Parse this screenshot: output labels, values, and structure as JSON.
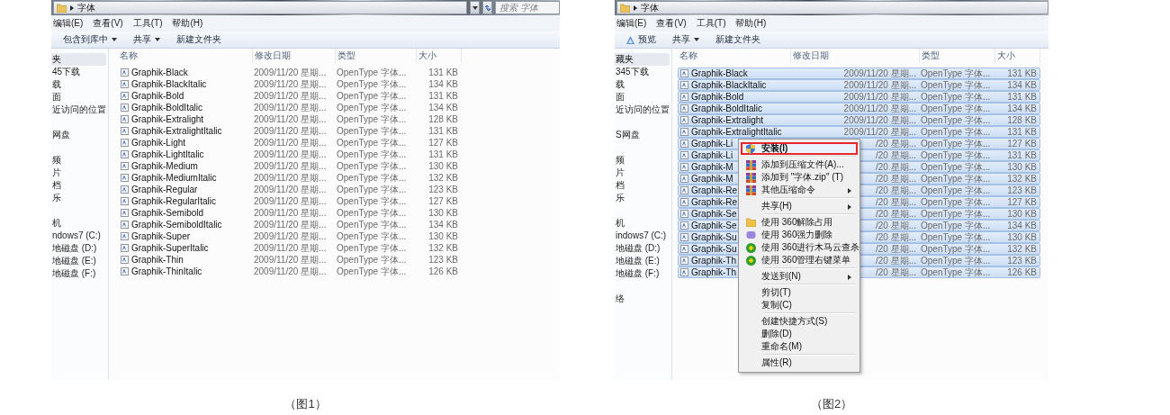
{
  "panels": [
    {
      "address": {
        "path": "字体",
        "search_placeholder": "搜索 字体"
      },
      "menu": [
        "编辑(E)",
        "查看(V)",
        "工具(T)",
        "帮助(H)"
      ],
      "toolbar": [
        {
          "kind": "plain",
          "label": "包含到库中",
          "dropdown": true
        },
        {
          "kind": "plain",
          "label": "共享",
          "dropdown": true
        },
        {
          "kind": "plain",
          "label": "新建文件夹",
          "dropdown": false
        }
      ],
      "sidebar": [
        {
          "items": [
            {
              "label": "夹",
              "selected": true
            },
            {
              "label": "45下载",
              "selected": false
            },
            {
              "label": "载",
              "selected": false
            },
            {
              "label": "面",
              "selected": false
            },
            {
              "label": "近访问的位置",
              "selected": false
            }
          ]
        },
        {
          "items": [
            {
              "label": "网盘",
              "selected": false
            }
          ]
        },
        {
          "items": [
            {
              "label": "频",
              "selected": false
            },
            {
              "label": "片",
              "selected": false
            },
            {
              "label": "档",
              "selected": false
            },
            {
              "label": "乐",
              "selected": false
            }
          ]
        },
        {
          "items": [
            {
              "label": "机",
              "selected": false
            },
            {
              "label": "ndows7 (C:)",
              "selected": false
            },
            {
              "label": "地磁盘 (D:)",
              "selected": false
            },
            {
              "label": "地磁盘 (E:)",
              "selected": false
            },
            {
              "label": "地磁盘 (F:)",
              "selected": false
            }
          ]
        }
      ],
      "columns": [
        "名称",
        "修改日期",
        "类型",
        "大小"
      ],
      "files": [
        {
          "name": "Graphik-Black",
          "date": "2009/11/20 星期...",
          "type": "OpenType 字体...",
          "size": "131 KB",
          "selected": false
        },
        {
          "name": "Graphik-BlackItalic",
          "date": "2009/11/20 星期...",
          "type": "OpenType 字体...",
          "size": "134 KB",
          "selected": false
        },
        {
          "name": "Graphik-Bold",
          "date": "2009/11/20 星期...",
          "type": "OpenType 字体...",
          "size": "131 KB",
          "selected": false
        },
        {
          "name": "Graphik-BoldItalic",
          "date": "2009/11/20 星期...",
          "type": "OpenType 字体...",
          "size": "134 KB",
          "selected": false
        },
        {
          "name": "Graphik-Extralight",
          "date": "2009/11/20 星期...",
          "type": "OpenType 字体...",
          "size": "128 KB",
          "selected": false
        },
        {
          "name": "Graphik-ExtralightItalic",
          "date": "2009/11/20 星期...",
          "type": "OpenType 字体...",
          "size": "131 KB",
          "selected": false
        },
        {
          "name": "Graphik-Light",
          "date": "2009/11/20 星期...",
          "type": "OpenType 字体...",
          "size": "127 KB",
          "selected": false
        },
        {
          "name": "Graphik-LightItalic",
          "date": "2009/11/20 星期...",
          "type": "OpenType 字体...",
          "size": "131 KB",
          "selected": false
        },
        {
          "name": "Graphik-Medium",
          "date": "2009/11/20 星期...",
          "type": "OpenType 字体...",
          "size": "130 KB",
          "selected": false
        },
        {
          "name": "Graphik-MediumItalic",
          "date": "2009/11/20 星期...",
          "type": "OpenType 字体...",
          "size": "132 KB",
          "selected": false
        },
        {
          "name": "Graphik-Regular",
          "date": "2009/11/20 星期...",
          "type": "OpenType 字体...",
          "size": "123 KB",
          "selected": false
        },
        {
          "name": "Graphik-RegularItalic",
          "date": "2009/11/20 星期...",
          "type": "OpenType 字体...",
          "size": "127 KB",
          "selected": false
        },
        {
          "name": "Graphik-Semibold",
          "date": "2009/11/20 星期...",
          "type": "OpenType 字体...",
          "size": "130 KB",
          "selected": false
        },
        {
          "name": "Graphik-SemiboldItalic",
          "date": "2009/11/20 星期...",
          "type": "OpenType 字体...",
          "size": "134 KB",
          "selected": false
        },
        {
          "name": "Graphik-Super",
          "date": "2009/11/20 星期...",
          "type": "OpenType 字体...",
          "size": "130 KB",
          "selected": false
        },
        {
          "name": "Graphik-SuperItalic",
          "date": "2009/11/20 星期...",
          "type": "OpenType 字体...",
          "size": "132 KB",
          "selected": false
        },
        {
          "name": "Graphik-Thin",
          "date": "2009/11/20 星期...",
          "type": "OpenType 字体...",
          "size": "123 KB",
          "selected": false
        },
        {
          "name": "Graphik-ThinItalic",
          "date": "2009/11/20 星期...",
          "type": "OpenType 字体...",
          "size": "126 KB",
          "selected": false
        }
      ],
      "caption": "（图1）"
    },
    {
      "address": {
        "path": "字体"
      },
      "menu": [
        "编辑(E)",
        "查看(V)",
        "工具(T)",
        "帮助(H)"
      ],
      "toolbar": [
        {
          "kind": "preview",
          "label": "预览",
          "dropdown": false
        },
        {
          "kind": "plain",
          "label": "共享",
          "dropdown": true
        },
        {
          "kind": "plain",
          "label": "新建文件夹",
          "dropdown": false
        }
      ],
      "sidebar": [
        {
          "items": [
            {
              "label": "藏夹",
              "selected": true
            },
            {
              "label": "345下载",
              "selected": false
            },
            {
              "label": "载",
              "selected": false
            },
            {
              "label": "面",
              "selected": false
            },
            {
              "label": "近访问的位置",
              "selected": false
            }
          ]
        },
        {
          "items": [
            {
              "label": "S网盘",
              "selected": false
            }
          ]
        },
        {
          "items": [
            {
              "label": "频",
              "selected": false
            },
            {
              "label": "片",
              "selected": false
            },
            {
              "label": "档",
              "selected": false
            },
            {
              "label": "乐",
              "selected": false
            }
          ]
        },
        {
          "items": [
            {
              "label": "机",
              "selected": false
            },
            {
              "label": "indows7 (C:)",
              "selected": false
            },
            {
              "label": "地磁盘 (D:)",
              "selected": false
            },
            {
              "label": "地磁盘 (E:)",
              "selected": false
            },
            {
              "label": "地磁盘 (F:)",
              "selected": false
            }
          ]
        },
        {
          "items": [
            {
              "label": "络",
              "selected": false
            }
          ]
        }
      ],
      "columns": [
        "名称",
        "修改日期",
        "类型",
        "大小"
      ],
      "files": [
        {
          "name": "Graphik-Black",
          "date": "2009/11/20 星期...",
          "type": "OpenType 字体...",
          "size": "131 KB",
          "selected": true
        },
        {
          "name": "Graphik-BlackItalic",
          "date": "2009/11/20 星期...",
          "type": "OpenType 字体...",
          "size": "134 KB",
          "selected": true
        },
        {
          "name": "Graphik-Bold",
          "date": "2009/11/20 星期...",
          "type": "OpenType 字体...",
          "size": "131 KB",
          "selected": true
        },
        {
          "name": "Graphik-BoldItalic",
          "date": "2009/11/20 星期...",
          "type": "OpenType 字体...",
          "size": "134 KB",
          "selected": true
        },
        {
          "name": "Graphik-Extralight",
          "date": "2009/11/20 星期...",
          "type": "OpenType 字体...",
          "size": "128 KB",
          "selected": true
        },
        {
          "name": "Graphik-ExtralightItalic",
          "date": "2009/11/20 星期...",
          "type": "OpenType 字体...",
          "size": "131 KB",
          "selected": true
        },
        {
          "name": "Graphik-Li",
          "date": "/20 星期...",
          "type": "OpenType 字体...",
          "size": "127 KB",
          "selected": true
        },
        {
          "name": "Graphik-Li",
          "date": "/20 星期...",
          "type": "OpenType 字体...",
          "size": "131 KB",
          "selected": true
        },
        {
          "name": "Graphik-M",
          "date": "/20 星期...",
          "type": "OpenType 字体...",
          "size": "130 KB",
          "selected": true
        },
        {
          "name": "Graphik-M",
          "date": "/20 星期...",
          "type": "OpenType 字体...",
          "size": "132 KB",
          "selected": true
        },
        {
          "name": "Graphik-Re",
          "date": "/20 星期...",
          "type": "OpenType 字体...",
          "size": "123 KB",
          "selected": true
        },
        {
          "name": "Graphik-Re",
          "date": "/20 星期...",
          "type": "OpenType 字体...",
          "size": "127 KB",
          "selected": true
        },
        {
          "name": "Graphik-Se",
          "date": "/20 星期...",
          "type": "OpenType 字体...",
          "size": "130 KB",
          "selected": true
        },
        {
          "name": "Graphik-Se",
          "date": "/20 星期...",
          "type": "OpenType 字体...",
          "size": "134 KB",
          "selected": true
        },
        {
          "name": "Graphik-Su",
          "date": "/20 星期...",
          "type": "OpenType 字体...",
          "size": "130 KB",
          "selected": true
        },
        {
          "name": "Graphik-Su",
          "date": "/20 星期...",
          "type": "OpenType 字体...",
          "size": "132 KB",
          "selected": true
        },
        {
          "name": "Graphik-Th",
          "date": "/20 星期...",
          "type": "OpenType 字体...",
          "size": "123 KB",
          "selected": true
        },
        {
          "name": "Graphik-Th",
          "date": "/20 星期...",
          "type": "OpenType 字体...",
          "size": "126 KB",
          "selected": true
        }
      ],
      "context_menu": {
        "items": [
          {
            "kind": "shield",
            "label": "安装(I)",
            "highlighted": true,
            "submenu": false
          },
          {
            "kind": "separator"
          },
          {
            "kind": "archive",
            "label": "添加到压缩文件(A)...",
            "highlighted": false,
            "submenu": false
          },
          {
            "kind": "archive",
            "label": "添加到 \"字体.zip\" (T)",
            "highlighted": false,
            "submenu": false
          },
          {
            "kind": "archive",
            "label": "其他压缩命令",
            "highlighted": false,
            "submenu": true
          },
          {
            "kind": "separator"
          },
          {
            "kind": "text",
            "label": "共享(H)",
            "highlighted": false,
            "submenu": true
          },
          {
            "kind": "separator"
          },
          {
            "kind": "folder360",
            "label": "使用 360解除占用",
            "highlighted": false,
            "submenu": false
          },
          {
            "kind": "purge360",
            "label": "使用 360强力删除",
            "highlighted": false,
            "submenu": false
          },
          {
            "kind": "guard360",
            "label": "使用 360进行木马云查杀",
            "highlighted": false,
            "submenu": false
          },
          {
            "kind": "guard360",
            "label": "使用 360管理右键菜单",
            "highlighted": false,
            "submenu": false
          },
          {
            "kind": "separator"
          },
          {
            "kind": "text",
            "label": "发送到(N)",
            "highlighted": false,
            "submenu": true
          },
          {
            "kind": "separator"
          },
          {
            "kind": "text",
            "label": "剪切(T)",
            "highlighted": false,
            "submenu": false
          },
          {
            "kind": "text",
            "label": "复制(C)",
            "highlighted": false,
            "submenu": false
          },
          {
            "kind": "separator"
          },
          {
            "kind": "text",
            "label": "创建快捷方式(S)",
            "highlighted": false,
            "submenu": false
          },
          {
            "kind": "text",
            "label": "删除(D)",
            "highlighted": false,
            "submenu": false
          },
          {
            "kind": "text",
            "label": "重命名(M)",
            "highlighted": false,
            "submenu": false
          },
          {
            "kind": "separator"
          },
          {
            "kind": "text",
            "label": "属性(R)",
            "highlighted": false,
            "submenu": false
          }
        ]
      },
      "caption": "（图2）"
    }
  ]
}
